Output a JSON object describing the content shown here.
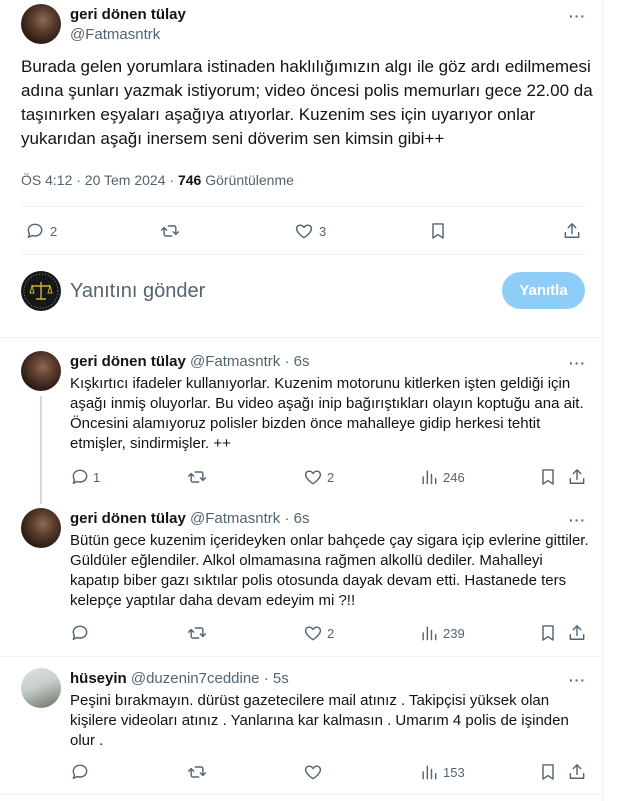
{
  "main_tweet": {
    "display_name": "geri dönen tülay",
    "handle": "@Fatmasntrk",
    "text": "Burada gelen yorumlara istinaden haklılığımızın algı ile göz ardı edilmemesi adına şunları yazmak istiyorum; video öncesi polis memurları gece 22.00 da taşınırken eşyaları aşağıya atıyorlar. Kuzenim ses için uyarıyor onlar yukarıdan aşağı inersem seni döverim sen kimsin gibi++",
    "time": "ÖS 4:12 · 20 Tem 2024 · ",
    "views_count": "746",
    "views_label": " Görüntülenme",
    "reply_count": "2",
    "like_count": "3",
    "more": "···"
  },
  "compose": {
    "placeholder": "Yanıtını gönder",
    "button_label": "Yanıtla"
  },
  "replies": [
    {
      "display_name": "geri dönen tülay",
      "handle": "@Fatmasntrk",
      "time": " · 6s",
      "text": "Kışkırtıcı ifadeler kullanıyorlar. Kuzenim motorunu kitlerken işten geldiği için aşağı inmiş oluyorlar. Bu video aşağı inip bağırıştıkları olayın koptuğu ana ait. Öncesini alamıyoruz polisler bizden önce mahalleye gidip herkesi tehtit etmişler, sindirmişler. ++",
      "reply_count": "1",
      "retweet_count": "",
      "like_count": "2",
      "views_count": "246",
      "more": "···"
    },
    {
      "display_name": "geri dönen tülay",
      "handle": "@Fatmasntrk",
      "time": " · 6s",
      "text": "Bütün gece kuzenim içerideyken onlar bahçede çay sigara içip evlerine gittiler. Güldüler eğlendiler. Alkol olmamasına rağmen alkollü dediler. Mahalleyi kapatıp biber gazı sıktılar polis otosunda dayak devam etti. Hastanede ters kelepçe yaptılar daha devam edeyim mi ?!!",
      "reply_count": "",
      "retweet_count": "",
      "like_count": "2",
      "views_count": "239",
      "more": "···"
    },
    {
      "display_name": "hüseyin",
      "handle": "@duzenin7ceddine",
      "time": " · 5s",
      "text": "Peşini  bırakmayın.   dürüst gazetecilere mail atınız . Takipçisi yüksek olan kişilere videoları atınız . Yanlarına kar kalmasın . Umarım 4 polis de işinden olur .",
      "reply_count": "",
      "retweet_count": "",
      "like_count": "",
      "views_count": "153",
      "more": "···"
    }
  ],
  "colors": {
    "accent_disabled": "#8ecdf7",
    "muted": "#536471",
    "text": "#0f1419",
    "divider": "#eff3f4"
  }
}
